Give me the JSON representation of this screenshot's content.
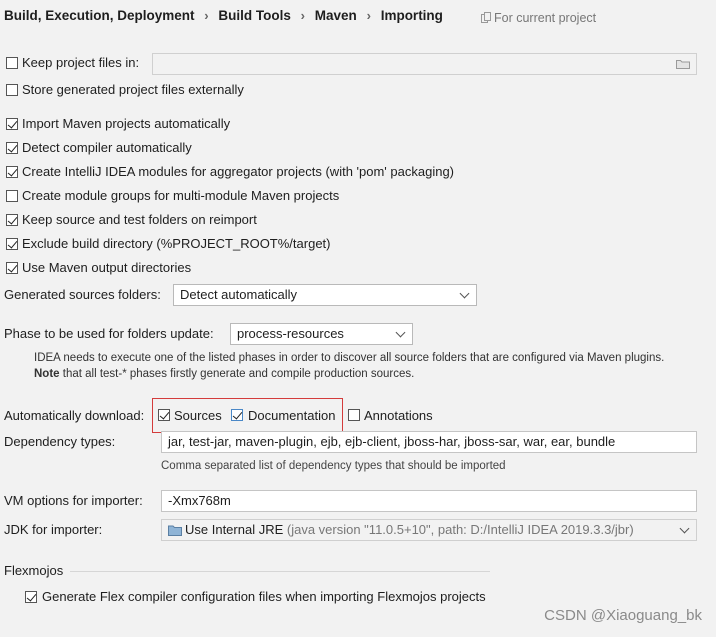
{
  "breadcrumb": {
    "items": [
      "Build, Execution, Deployment",
      "Build Tools",
      "Maven",
      "Importing"
    ],
    "separator": "›",
    "scope_label": "For current project"
  },
  "options": {
    "keep_project_files": {
      "label": "Keep project files in:",
      "checked": false
    },
    "store_externally": {
      "label": "Store generated project files externally",
      "checked": false
    },
    "import_auto": {
      "label": "Import Maven projects automatically",
      "checked": true
    },
    "detect_compiler": {
      "label": "Detect compiler automatically",
      "checked": true
    },
    "create_modules": {
      "label": "Create IntelliJ IDEA modules for aggregator projects (with 'pom' packaging)",
      "checked": true
    },
    "module_groups": {
      "label": "Create module groups for multi-module Maven projects",
      "checked": false
    },
    "keep_source_folders": {
      "label": "Keep source and test folders on reimport",
      "checked": true
    },
    "exclude_build_dir": {
      "label": "Exclude build directory (%PROJECT_ROOT%/target)",
      "checked": true
    },
    "use_output_dirs": {
      "label": "Use Maven output directories",
      "checked": true
    }
  },
  "generated_sources": {
    "label": "Generated sources folders:",
    "value": "Detect automatically"
  },
  "phase_update": {
    "label": "Phase to be used for folders update:",
    "value": "process-resources",
    "note_line1": "IDEA needs to execute one of the listed phases in order to discover all source folders that are configured via Maven plugins.",
    "note_bold": "Note",
    "note_line2": " that all test-* phases firstly generate and compile production sources."
  },
  "auto_download": {
    "label": "Automatically download:",
    "sources": {
      "label": "Sources",
      "checked": true
    },
    "documentation": {
      "label": "Documentation",
      "checked": true
    },
    "annotations": {
      "label": "Annotations",
      "checked": false
    },
    "highlight_color": "#d43c3c"
  },
  "dependency_types": {
    "label": "Dependency types:",
    "value": "jar, test-jar, maven-plugin, ejb, ejb-client, jboss-har, jboss-sar, war, ear, bundle",
    "hint": "Comma separated list of dependency types that should be imported"
  },
  "vm_options": {
    "label": "VM options for importer:",
    "value": "-Xmx768m"
  },
  "jdk": {
    "label": "JDK for importer:",
    "value": "Use Internal JRE",
    "detail": " (java version \"11.0.5+10\", path: D:/IntelliJ IDEA 2019.3.3/jbr)"
  },
  "flexmojos": {
    "section_title": "Flexmojos",
    "generate_config": {
      "label": "Generate Flex compiler configuration files when importing Flexmojos projects",
      "checked": true
    }
  },
  "watermark": "CSDN @Xiaoguang_bk"
}
